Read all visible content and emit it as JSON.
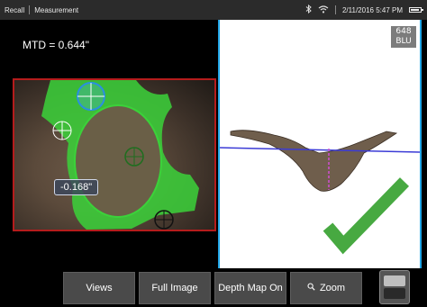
{
  "status_bar": {
    "mode_label": "Recall",
    "screen_label": "Measurement",
    "datetime": "2/11/2016 5:47 PM",
    "icons": [
      "bluetooth-icon",
      "wifi-icon",
      "battery-icon"
    ]
  },
  "measurement": {
    "mtd_text": "MTD = 0.644\"",
    "point_value": "-0.168\""
  },
  "profile_view": {
    "badge_line1": "648",
    "badge_line2": "BLU",
    "result_icon": "checkmark-icon"
  },
  "colors": {
    "accent_blue": "#22a7e8",
    "frame_red": "#b51c1c",
    "overlay_green": "#3bd23a",
    "check_green": "#47a941",
    "profile_line": "#3b3bd6",
    "depth_line": "#d24fd4"
  },
  "toolbar": {
    "views_label": "Views",
    "full_image_label": "Full Image",
    "depth_map_label": "Depth Map On",
    "zoom_label": "Zoom",
    "zoom_icon": "magnifier-icon"
  }
}
